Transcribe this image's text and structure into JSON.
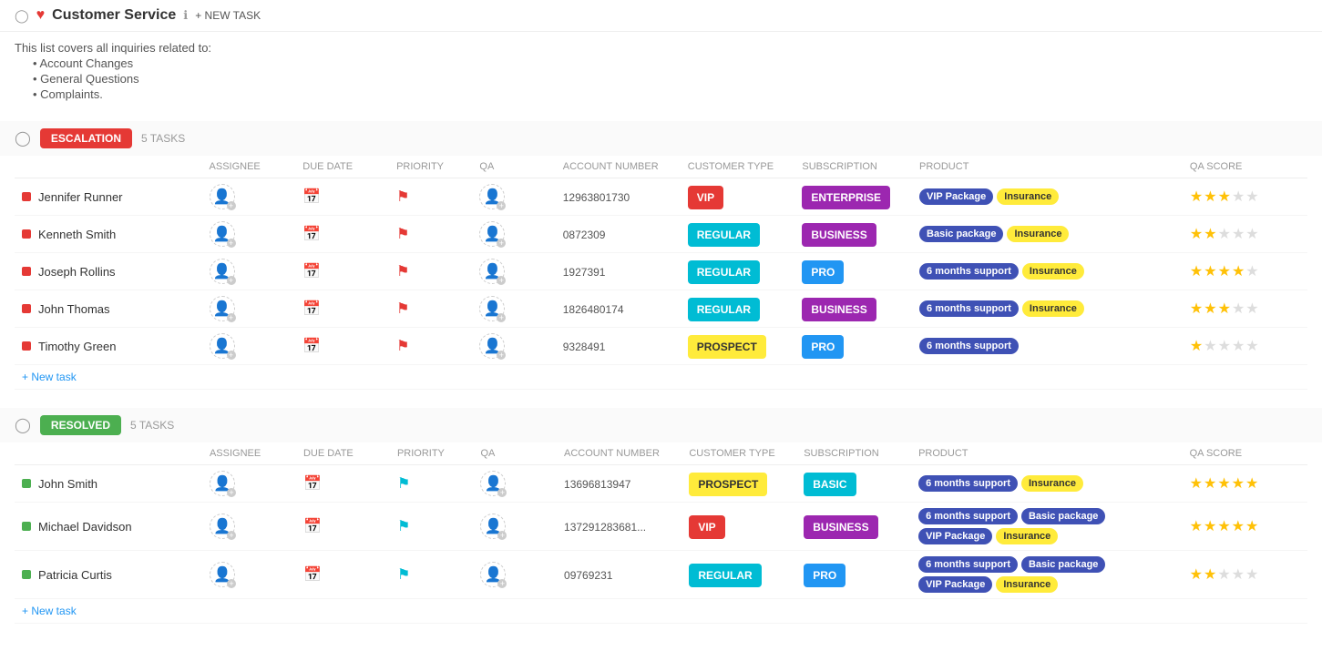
{
  "header": {
    "back_label": "←",
    "title": "Customer Service",
    "info_label": "ℹ",
    "new_task_label": "+ NEW TASK"
  },
  "description": {
    "intro": "This list covers all inquiries related to:",
    "items": [
      "Account Changes",
      "General Questions",
      "Complaints."
    ]
  },
  "columns": {
    "task": "",
    "assignee": "ASSIGNEE",
    "due_date": "DUE DATE",
    "priority": "PRIORITY",
    "qa": "QA",
    "account_number": "ACCOUNT NUMBER",
    "customer_type": "CUSTOMER TYPE",
    "subscription": "SUBSCRIPTION",
    "product": "PRODUCT",
    "qa_score": "QA SCORE"
  },
  "groups": [
    {
      "id": "escalation",
      "label": "ESCALATION",
      "badge_class": "badge-escalation",
      "task_count": "5 TASKS",
      "tasks": [
        {
          "name": "Jennifer Runner",
          "dot": "red",
          "account_number": "12963801730",
          "customer_type": "VIP",
          "ct_class": "ct-vip",
          "subscription": "ENTERPRISE",
          "sub_class": "sub-enterprise",
          "products": [
            {
              "label": "VIP Package",
              "class": "tag-vip-pkg"
            },
            {
              "label": "Insurance",
              "class": "tag-insurance"
            }
          ],
          "stars": [
            1,
            1,
            1,
            0,
            0
          ],
          "flag_class": "flag-red"
        },
        {
          "name": "Kenneth Smith",
          "dot": "red",
          "account_number": "0872309",
          "customer_type": "REGULAR",
          "ct_class": "ct-regular",
          "subscription": "BUSINESS",
          "sub_class": "sub-business",
          "products": [
            {
              "label": "Basic package",
              "class": "tag-basic-pkg"
            },
            {
              "label": "Insurance",
              "class": "tag-insurance"
            }
          ],
          "stars": [
            1,
            1,
            0,
            0,
            0
          ],
          "flag_class": "flag-red"
        },
        {
          "name": "Joseph Rollins",
          "dot": "red",
          "account_number": "1927391",
          "customer_type": "REGULAR",
          "ct_class": "ct-regular",
          "subscription": "PRO",
          "sub_class": "sub-pro",
          "products": [
            {
              "label": "6 months support",
              "class": "tag-6mo"
            },
            {
              "label": "Insurance",
              "class": "tag-insurance"
            }
          ],
          "stars": [
            1,
            1,
            1,
            1,
            0
          ],
          "flag_class": "flag-red"
        },
        {
          "name": "John Thomas",
          "dot": "red",
          "account_number": "1826480174",
          "customer_type": "REGULAR",
          "ct_class": "ct-regular",
          "subscription": "BUSINESS",
          "sub_class": "sub-business",
          "products": [
            {
              "label": "6 months support",
              "class": "tag-6mo"
            },
            {
              "label": "Insurance",
              "class": "tag-insurance"
            }
          ],
          "stars": [
            1,
            1,
            1,
            0,
            0
          ],
          "flag_class": "flag-red"
        },
        {
          "name": "Timothy Green",
          "dot": "red",
          "account_number": "9328491",
          "customer_type": "PROSPECT",
          "ct_class": "ct-prospect",
          "subscription": "PRO",
          "sub_class": "sub-pro",
          "products": [
            {
              "label": "6 months support",
              "class": "tag-6mo"
            }
          ],
          "stars": [
            1,
            0,
            0,
            0,
            0
          ],
          "flag_class": "flag-red"
        }
      ],
      "new_task_label": "+ New task"
    },
    {
      "id": "resolved",
      "label": "RESOLVED",
      "badge_class": "badge-resolved",
      "task_count": "5 TASKS",
      "tasks": [
        {
          "name": "John Smith",
          "dot": "green",
          "account_number": "13696813947",
          "customer_type": "PROSPECT",
          "ct_class": "ct-prospect",
          "subscription": "BASIC",
          "sub_class": "sub-basic",
          "products": [
            {
              "label": "6 months support",
              "class": "tag-6mo"
            },
            {
              "label": "Insurance",
              "class": "tag-insurance"
            }
          ],
          "stars": [
            1,
            1,
            1,
            1,
            1
          ],
          "flag_class": "flag-cyan"
        },
        {
          "name": "Michael Davidson",
          "dot": "green",
          "account_number": "137291283681...",
          "customer_type": "VIP",
          "ct_class": "ct-vip",
          "subscription": "BUSINESS",
          "sub_class": "sub-business",
          "products": [
            {
              "label": "6 months support",
              "class": "tag-6mo"
            },
            {
              "label": "Basic package",
              "class": "tag-basic-pkg"
            },
            {
              "label": "VIP Package",
              "class": "tag-vip-pkg"
            },
            {
              "label": "Insurance",
              "class": "tag-insurance"
            }
          ],
          "stars": [
            1,
            1,
            1,
            1,
            1
          ],
          "flag_class": "flag-cyan"
        },
        {
          "name": "Patricia Curtis",
          "dot": "green",
          "account_number": "09769231",
          "customer_type": "REGULAR",
          "ct_class": "ct-regular",
          "subscription": "PRO",
          "sub_class": "sub-pro",
          "products": [
            {
              "label": "6 months support",
              "class": "tag-6mo"
            },
            {
              "label": "Basic package",
              "class": "tag-basic-pkg"
            },
            {
              "label": "VIP Package",
              "class": "tag-vip-pkg"
            },
            {
              "label": "Insurance",
              "class": "tag-insurance"
            }
          ],
          "stars": [
            1,
            1,
            0,
            0,
            0
          ],
          "flag_class": "flag-cyan"
        }
      ],
      "new_task_label": "+ New task"
    }
  ]
}
